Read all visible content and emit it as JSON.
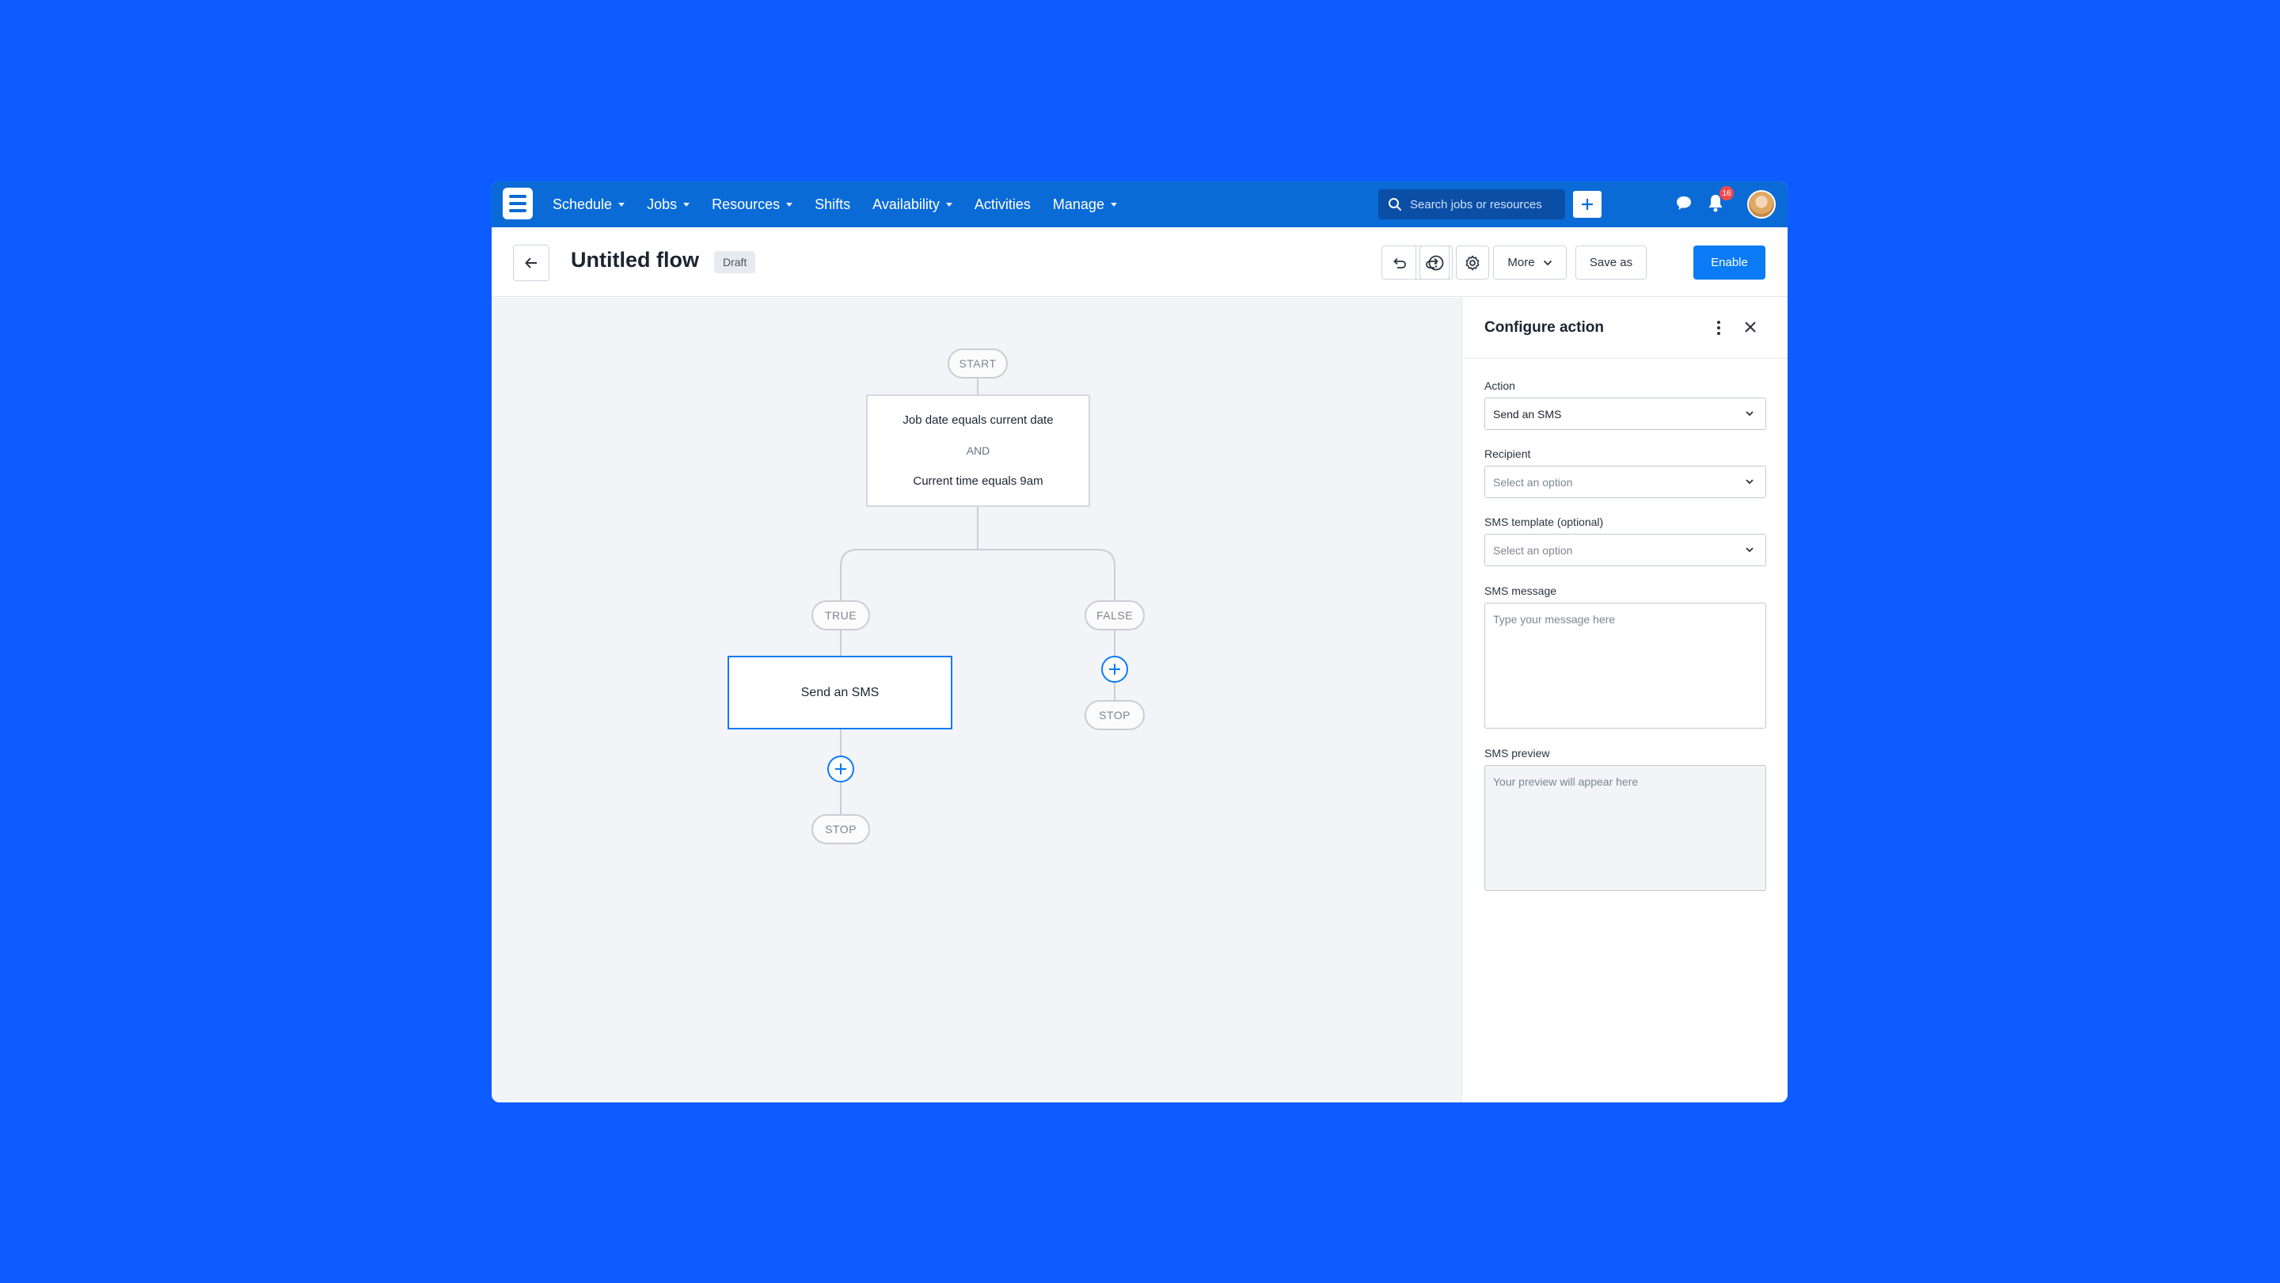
{
  "nav": {
    "items": [
      {
        "label": "Schedule",
        "dropdown": true
      },
      {
        "label": "Jobs",
        "dropdown": true
      },
      {
        "label": "Resources",
        "dropdown": true
      },
      {
        "label": "Shifts",
        "dropdown": false
      },
      {
        "label": "Availability",
        "dropdown": true
      },
      {
        "label": "Activities",
        "dropdown": false
      },
      {
        "label": "Manage",
        "dropdown": true
      }
    ],
    "search_placeholder": "Search jobs or resources",
    "notification_count": "16"
  },
  "header": {
    "title": "Untitled flow",
    "status_badge": "Draft",
    "more_label": "More",
    "save_as_label": "Save as",
    "enable_label": "Enable"
  },
  "flow": {
    "start_label": "START",
    "condition_1": "Job date equals current date",
    "condition_join": "AND",
    "condition_2": "Current time equals 9am",
    "true_label": "TRUE",
    "false_label": "FALSE",
    "action_label": "Send an SMS",
    "stop_label_true": "STOP",
    "stop_label_false": "STOP"
  },
  "panel": {
    "title": "Configure action",
    "action_label": "Action",
    "action_value": "Send an SMS",
    "recipient_label": "Recipient",
    "recipient_placeholder": "Select an option",
    "template_label": "SMS template (optional)",
    "template_placeholder": "Select an option",
    "message_label": "SMS message",
    "message_placeholder": "Type your message here",
    "preview_label": "SMS preview",
    "preview_placeholder": "Your preview will appear here"
  },
  "colors": {
    "background": "#0c5cff",
    "nav": "#0a6bd6",
    "accent": "#0a7bf5",
    "badge": "#f24a4a"
  }
}
